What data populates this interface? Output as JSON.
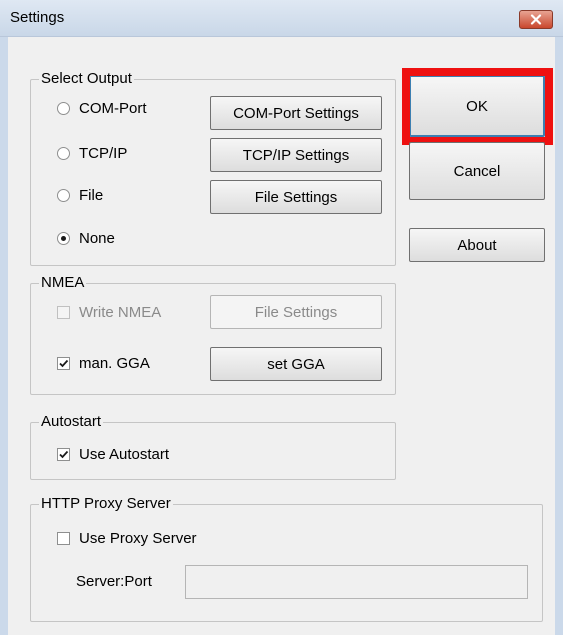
{
  "window": {
    "title": "Settings"
  },
  "icons": {
    "close": "close-icon",
    "check": "checkmark-icon"
  },
  "colors": {
    "highlight": "#ee1111",
    "title_bar": "#cbd9ea",
    "close_button": "#c9472d"
  },
  "select_output": {
    "legend": "Select Output",
    "options": [
      {
        "label": "COM-Port",
        "selected": false
      },
      {
        "label": "TCP/IP",
        "selected": false
      },
      {
        "label": "File",
        "selected": false
      },
      {
        "label": "None",
        "selected": true
      }
    ],
    "buttons": [
      "COM-Port Settings",
      "TCP/IP Settings",
      "File Settings"
    ]
  },
  "actions": {
    "ok": "OK",
    "cancel": "Cancel",
    "about": "About"
  },
  "nmea": {
    "legend": "NMEA",
    "write_nmea": {
      "label": "Write NMEA",
      "checked": false,
      "enabled": false
    },
    "file_settings": "File Settings",
    "man_gga": {
      "label": "man. GGA",
      "checked": true
    },
    "set_gga": "set GGA"
  },
  "autostart": {
    "legend": "Autostart",
    "use_autostart": {
      "label": "Use Autostart",
      "checked": true
    }
  },
  "proxy": {
    "legend": "HTTP Proxy Server",
    "use_proxy": {
      "label": "Use Proxy Server",
      "checked": false
    },
    "server_port_label": "Server:Port",
    "server_port_value": ""
  }
}
